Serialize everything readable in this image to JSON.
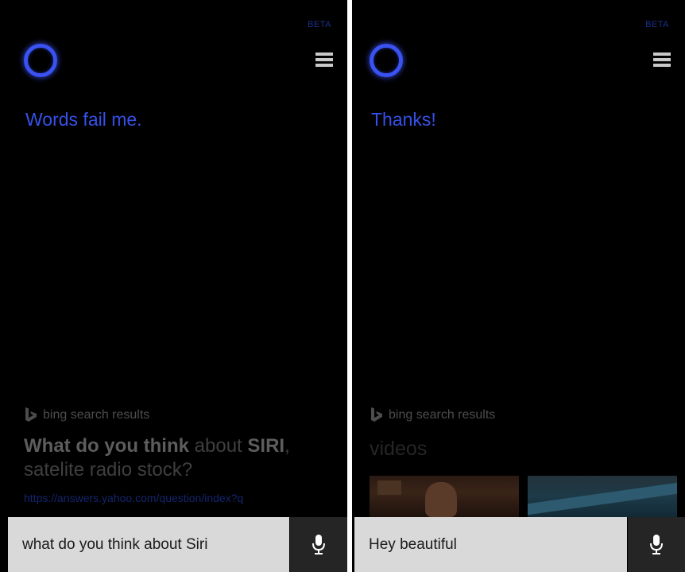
{
  "left_screen": {
    "beta_label": "BETA",
    "response": "Words fail me.",
    "bing_label": "bing search results",
    "result": {
      "part1": "What do you think",
      "part2": "about",
      "part3": "SIRI",
      "part4": ",",
      "line2": "satelite radio stock?"
    },
    "link": "https://answers.yahoo.com/question/index?q",
    "query": "what do you think about Siri"
  },
  "right_screen": {
    "beta_label": "BETA",
    "response": "Thanks!",
    "bing_label": "bing search results",
    "videos_label": "videos",
    "query": "Hey beautiful"
  },
  "colors": {
    "accent": "#3551e8",
    "background": "#000000",
    "search_bar": "#d9d9d9",
    "mic_button": "#252525"
  },
  "icons": [
    "cortana-icon",
    "hamburger-menu-icon",
    "bing-logo-icon",
    "microphone-icon"
  ]
}
